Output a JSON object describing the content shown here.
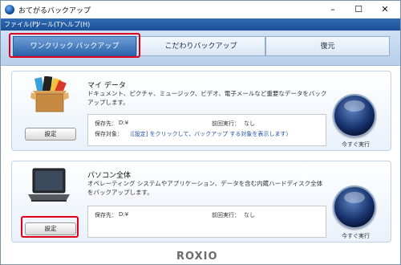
{
  "window": {
    "title": "おてがるバックアップ",
    "minimize_glyph": "–",
    "maximize_glyph": "☐",
    "close_glyph": "✕"
  },
  "menu": {
    "items": [
      {
        "label": "ファイル(F)"
      },
      {
        "label": "ツール(T)"
      },
      {
        "label": "ヘルプ(H)"
      }
    ]
  },
  "tabs": [
    {
      "label": "ワンクリック バックアップ",
      "active": true
    },
    {
      "label": "こだわりバックアップ",
      "active": false
    },
    {
      "label": "復元",
      "active": false
    }
  ],
  "sections": [
    {
      "title": "マイ データ",
      "description": "ドキュメント、ピクチャ、ミュージック、ビデオ、電子メールなど重要なデータをバックアップします。",
      "save_to_label": "保存先：",
      "save_to_value": "D:¥",
      "last_run_label": "前回実行：",
      "last_run_value": "なし",
      "target_label": "保存対象：",
      "target_value": "（[設定] をクリックして、バックアップ する対象を表示します）",
      "settings_label": "設定",
      "run_label": "今すぐ実行"
    },
    {
      "title": "パソコン全体",
      "description": "オペレーティング システムやアプリケーション、データを含む内蔵ハードディスク全体をバックアップします。",
      "save_to_label": "保存先：",
      "save_to_value": "D:¥",
      "last_run_label": "前回実行：",
      "last_run_value": "なし",
      "settings_label": "設定",
      "run_label": "今すぐ実行"
    }
  ],
  "footer": {
    "logo_text": "ROXIO"
  },
  "colors": {
    "highlight": "#e0001b",
    "menubar": "#1c4f96",
    "active_tab": "#2b63ad"
  }
}
